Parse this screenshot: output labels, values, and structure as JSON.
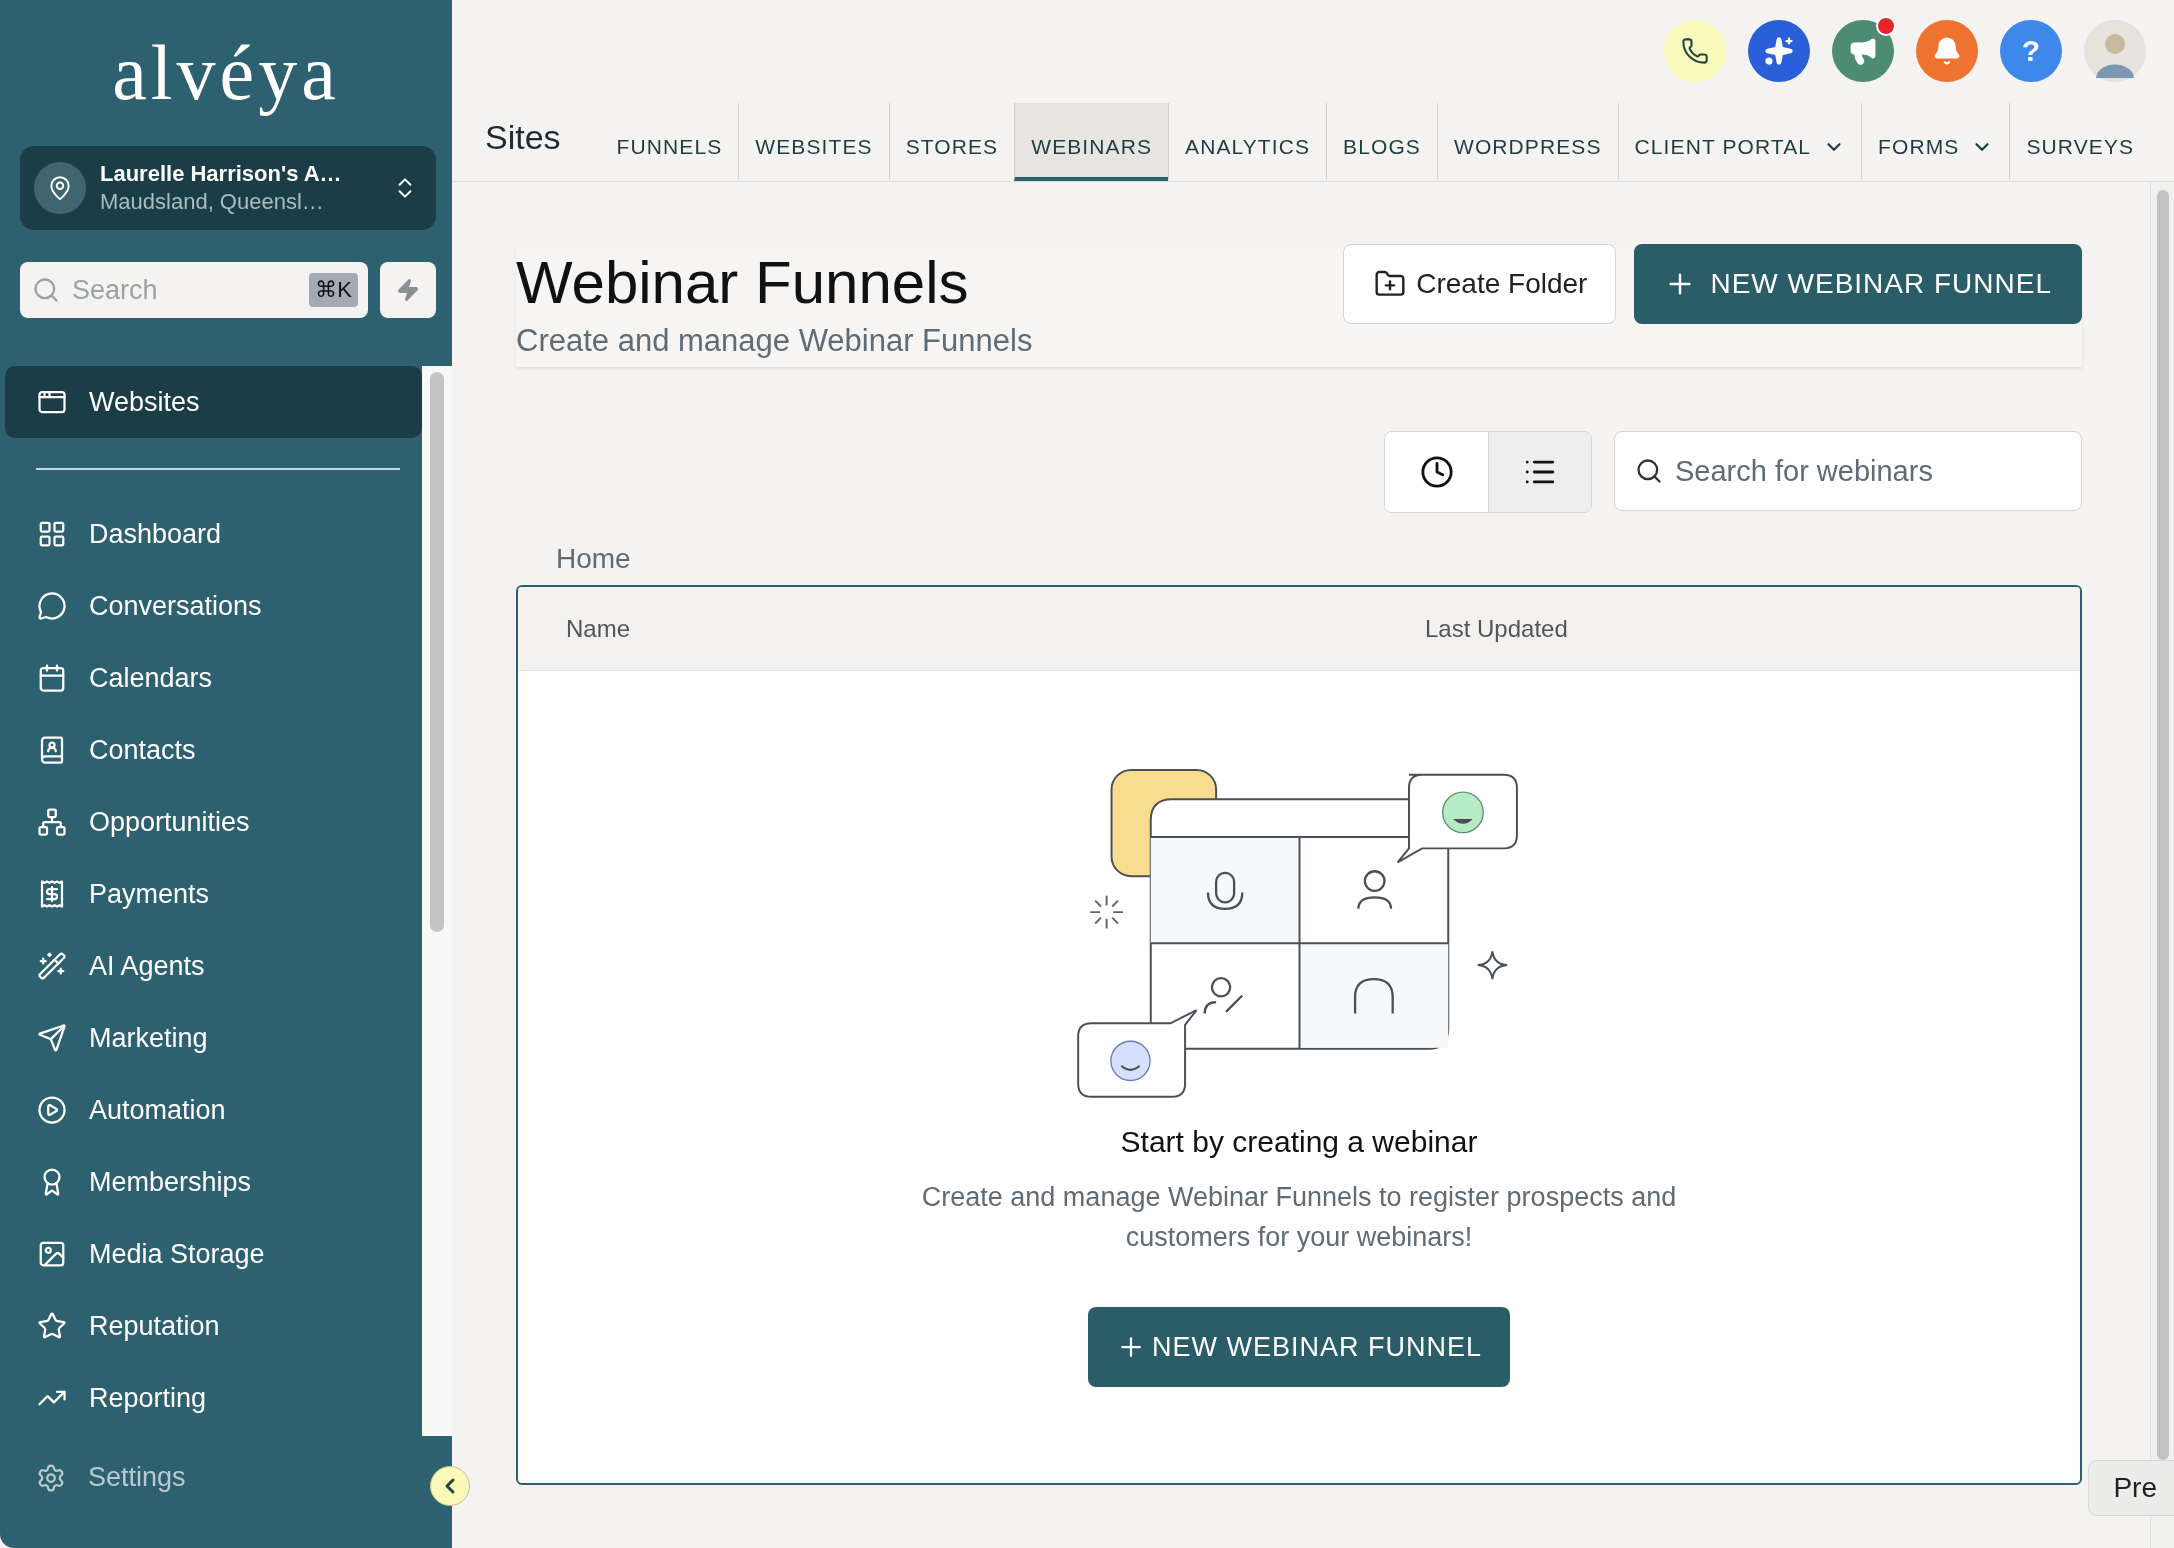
{
  "sidebar": {
    "logo": "alvéya",
    "account": {
      "name": "Laurelle Harrison's A…",
      "location": "Maudsland, Queensl…"
    },
    "search": {
      "placeholder": "Search",
      "shortcut": "⌘K"
    },
    "pinned_item": {
      "label": "Websites",
      "selected": true
    },
    "nav_items": [
      {
        "label": "Dashboard",
        "selected": false
      },
      {
        "label": "Conversations",
        "selected": false
      },
      {
        "label": "Calendars",
        "selected": false
      },
      {
        "label": "Contacts",
        "selected": false
      },
      {
        "label": "Opportunities",
        "selected": false
      },
      {
        "label": "Payments",
        "selected": false
      },
      {
        "label": "AI Agents",
        "selected": false
      },
      {
        "label": "Marketing",
        "selected": false
      },
      {
        "label": "Automation",
        "selected": false
      },
      {
        "label": "Memberships",
        "selected": false
      },
      {
        "label": "Media Storage",
        "selected": false
      },
      {
        "label": "Reputation",
        "selected": false
      },
      {
        "label": "Reporting",
        "selected": false
      }
    ],
    "settings": {
      "label": "Settings"
    }
  },
  "topbar": {
    "actions": [
      {
        "kind": "phone",
        "badge": false
      },
      {
        "kind": "sparkle",
        "badge": false
      },
      {
        "kind": "megaphone",
        "badge": true
      },
      {
        "kind": "bell",
        "badge": false
      },
      {
        "kind": "help",
        "badge": false,
        "label": "?"
      },
      {
        "kind": "avatar",
        "badge": false
      }
    ],
    "title": "Sites",
    "tabs": [
      {
        "label": "FUNNELS",
        "selected": false,
        "dropdown": false
      },
      {
        "label": "WEBSITES",
        "selected": false,
        "dropdown": false
      },
      {
        "label": "STORES",
        "selected": false,
        "dropdown": false
      },
      {
        "label": "WEBINARS",
        "selected": true,
        "dropdown": false
      },
      {
        "label": "ANALYTICS",
        "selected": false,
        "dropdown": false
      },
      {
        "label": "BLOGS",
        "selected": false,
        "dropdown": false
      },
      {
        "label": "WORDPRESS",
        "selected": false,
        "dropdown": false
      },
      {
        "label": "CLIENT PORTAL",
        "selected": false,
        "dropdown": true
      },
      {
        "label": "FORMS",
        "selected": false,
        "dropdown": true
      },
      {
        "label": "SURVEYS",
        "selected": false,
        "dropdown": false
      }
    ]
  },
  "page": {
    "title": "Webinar Funnels",
    "subtitle": "Create and manage Webinar Funnels",
    "create_folder": "Create Folder",
    "new_button": "NEW WEBINAR FUNNEL",
    "view_toggle": [
      {
        "kind": "recent",
        "selected": false
      },
      {
        "kind": "list",
        "selected": true
      }
    ],
    "search": {
      "placeholder": "Search for webinars"
    },
    "breadcrumb": "Home",
    "table": {
      "columns": [
        "Name",
        "Last Updated"
      ],
      "empty_state": {
        "title": "Start by creating a webinar",
        "description": "Create and manage Webinar Funnels to register prospects and customers for your webinars!",
        "button": "NEW WEBINAR FUNNEL"
      }
    }
  },
  "corner_button": {
    "label": "Pre"
  }
}
